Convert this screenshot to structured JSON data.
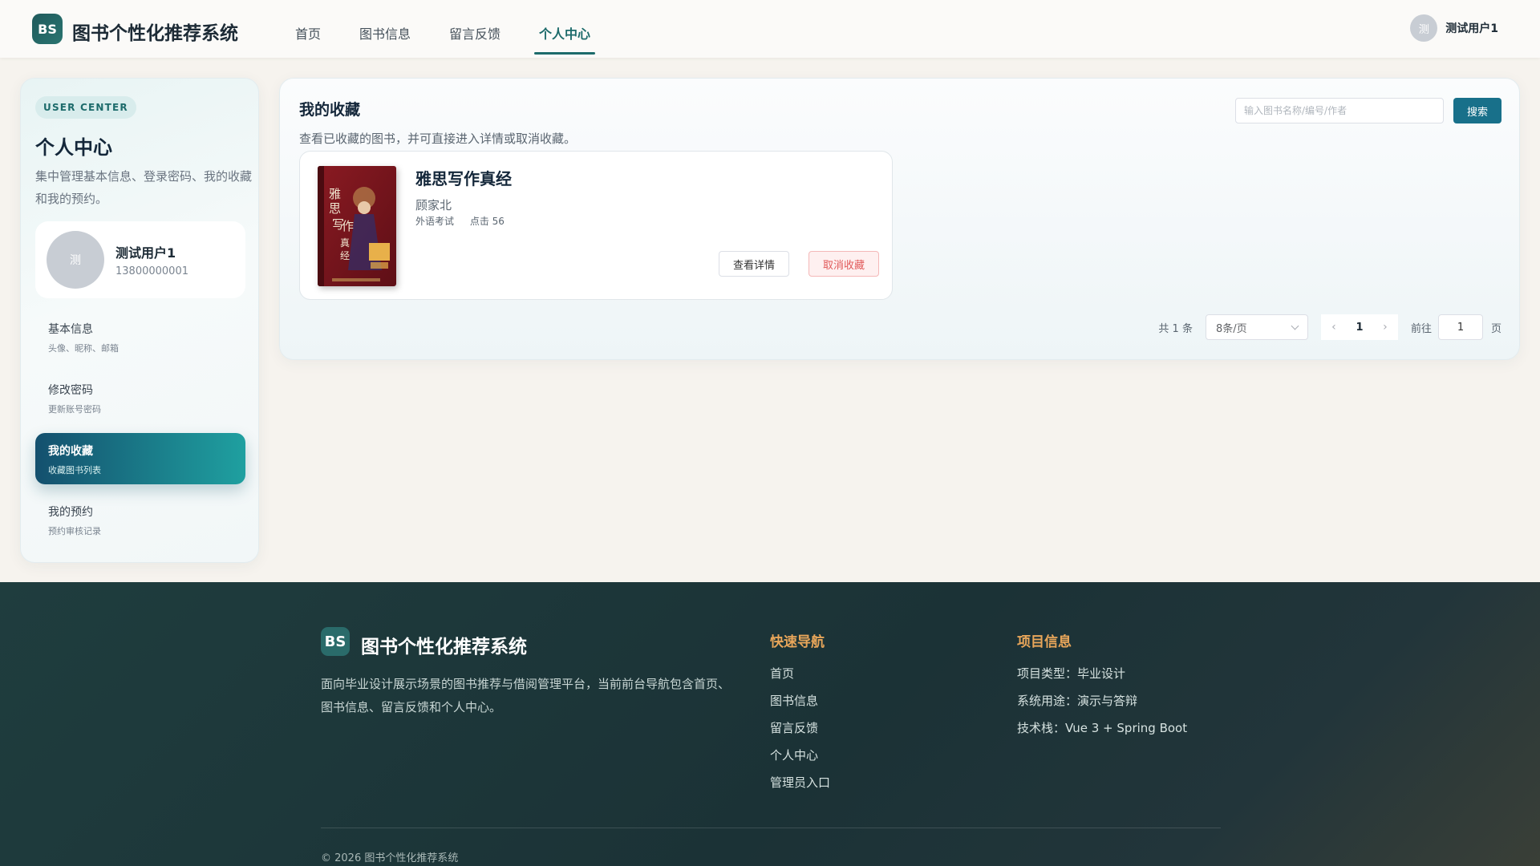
{
  "header": {
    "logo_text": "BS",
    "brand": "图书个性化推荐系统",
    "nav": [
      "首页",
      "图书信息",
      "留言反馈",
      "个人中心"
    ],
    "active_nav": "个人中心",
    "user": {
      "avatar_text": "测",
      "name": "测试用户1"
    }
  },
  "sidebar": {
    "badge": "USER CENTER",
    "title": "个人中心",
    "description": "集中管理基本信息、登录密码、我的收藏和我的预约。",
    "profile": {
      "avatar_text": "测",
      "name": "测试用户1",
      "phone": "13800000001"
    },
    "menu": [
      {
        "title": "基本信息",
        "subtitle": "头像、昵称、邮箱"
      },
      {
        "title": "修改密码",
        "subtitle": "更新账号密码"
      },
      {
        "title": "我的收藏",
        "subtitle": "收藏图书列表"
      },
      {
        "title": "我的预约",
        "subtitle": "预约审核记录"
      }
    ],
    "active_menu": "我的收藏"
  },
  "main": {
    "title": "我的收藏",
    "description": "查看已收藏的图书，并可直接进入详情或取消收藏。",
    "search": {
      "placeholder": "输入图书名称/编号/作者",
      "value": "",
      "button": "搜索"
    },
    "books": [
      {
        "title": "雅思写作真经",
        "author": "顾家北",
        "category": "外语考试",
        "clicks": "点击 56",
        "detail_button": "查看详情",
        "cancel_button": "取消收藏",
        "cover_text": "雅思写作真经"
      }
    ],
    "pagination": {
      "total": "共 1 条",
      "page_size": "8条/页",
      "current_page": "1",
      "goto_label": "前往",
      "goto_value": "1",
      "page_unit": "页"
    }
  },
  "footer": {
    "logo_text": "BS",
    "brand": "图书个性化推荐系统",
    "description": "面向毕业设计展示场景的图书推荐与借阅管理平台，当前前台导航包含首页、图书信息、留言反馈和个人中心。",
    "quick_nav_title": "快速导航",
    "quick_nav": [
      "首页",
      "图书信息",
      "留言反馈",
      "个人中心",
      "管理员入口"
    ],
    "project_title": "项目信息",
    "project_info": [
      "项目类型：毕业设计",
      "系统用途：演示与答辩",
      "技术栈：Vue 3 + Spring Boot"
    ],
    "copyright": "© 2026 图书个性化推荐系统"
  },
  "colors": {
    "accent": "#1d6b6b",
    "primary_button": "#18708a",
    "danger": "#e15a5a",
    "footer_heading": "#e8a65a"
  }
}
